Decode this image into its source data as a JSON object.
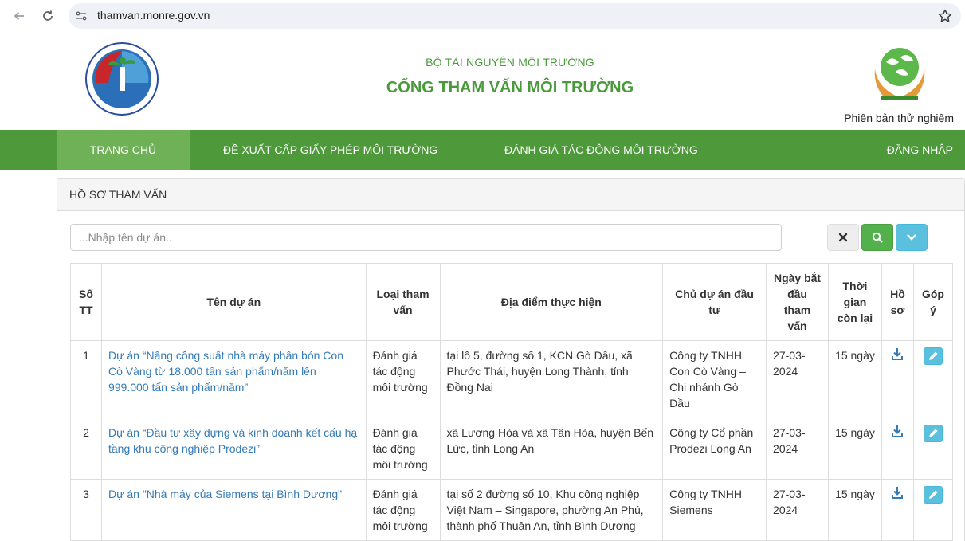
{
  "browser": {
    "url": "thamvan.monre.gov.vn"
  },
  "header": {
    "ministry": "BỘ TÀI NGUYÊN MÔI TRƯỜNG",
    "title": "CỔNG THAM VẤN MÔI TRƯỜNG",
    "trial_label": "Phiên bản thử nghiệm",
    "logo_text": "TÀI NGUYÊN VÀ MÔI TRƯỜNG"
  },
  "nav": {
    "home": "TRANG CHỦ",
    "propose": "ĐỀ XUẤT CẤP GIẤY PHÉP MÔI TRƯỜNG",
    "assess": "ĐÁNH GIÁ TÁC ĐỘNG MÔI TRƯỜNG",
    "login": "ĐĂNG NHẬP"
  },
  "panel": {
    "heading": "HỒ SƠ THAM VẤN",
    "search_placeholder": "...Nhập tên dự án.."
  },
  "table": {
    "headers": {
      "stt": "Số TT",
      "name": "Tên dự án",
      "type": "Loại tham vấn",
      "location": "Địa điểm thực hiện",
      "owner": "Chủ dự án đầu tư",
      "start": "Ngày bắt đầu tham vấn",
      "remaining": "Thời gian còn lại",
      "file": "Hồ sơ",
      "comment": "Góp ý"
    },
    "rows": [
      {
        "stt": "1",
        "name": "Dự án “Nâng công suất nhà máy phân bón Con Cò Vàng từ 18.000 tấn sản phẩm/năm lên 999.000 tấn sản phẩm/năm”",
        "type": "Đánh giá tác động môi trường",
        "location": "tại lô 5, đường số 1, KCN Gò Dầu, xã Phước Thái, huyện Long Thành, tỉnh Đồng Nai",
        "owner": "Công ty TNHH Con Cò Vàng – Chi nhánh Gò Dầu",
        "start": "27-03-2024",
        "remaining": "15 ngày"
      },
      {
        "stt": "2",
        "name": "Dự án “Đầu tư xây dựng và kinh doanh kết cấu hạ tầng khu công nghiệp Prodezi”",
        "type": "Đánh giá tác động môi trường",
        "location": "xã Lương Hòa và xã Tân Hòa, huyện Bến Lức, tỉnh Long An",
        "owner": "Công ty Cổ phần Prodezi Long An",
        "start": "27-03-2024",
        "remaining": "15 ngày"
      },
      {
        "stt": "3",
        "name": "Dự án \"Nhà máy của Siemens tại Bình Dương\"",
        "type": "Đánh giá tác động môi trường",
        "location": "tại số 2 đường số 10, Khu công nghiệp Việt Nam – Singapore, phường An Phú, thành phố Thuận An, tỉnh Bình Dương",
        "owner": "Công ty TNHH Siemens",
        "start": "27-03-2024",
        "remaining": "15 ngày"
      }
    ]
  },
  "icons": {
    "back": "arrow-left-icon",
    "reload": "reload-icon",
    "site_info": "site-info-icon",
    "bookmark": "star-icon",
    "clear": "close-icon",
    "search": "search-icon",
    "expand": "chevron-down-icon",
    "download": "download-icon",
    "comment": "pencil-icon"
  },
  "colors": {
    "nav_green": "#4e9a3b",
    "nav_active": "#6fb157",
    "title_green": "#4a9a3c",
    "link_blue": "#337ab7",
    "search_green": "#52b14a",
    "info_blue": "#5bc0de"
  }
}
